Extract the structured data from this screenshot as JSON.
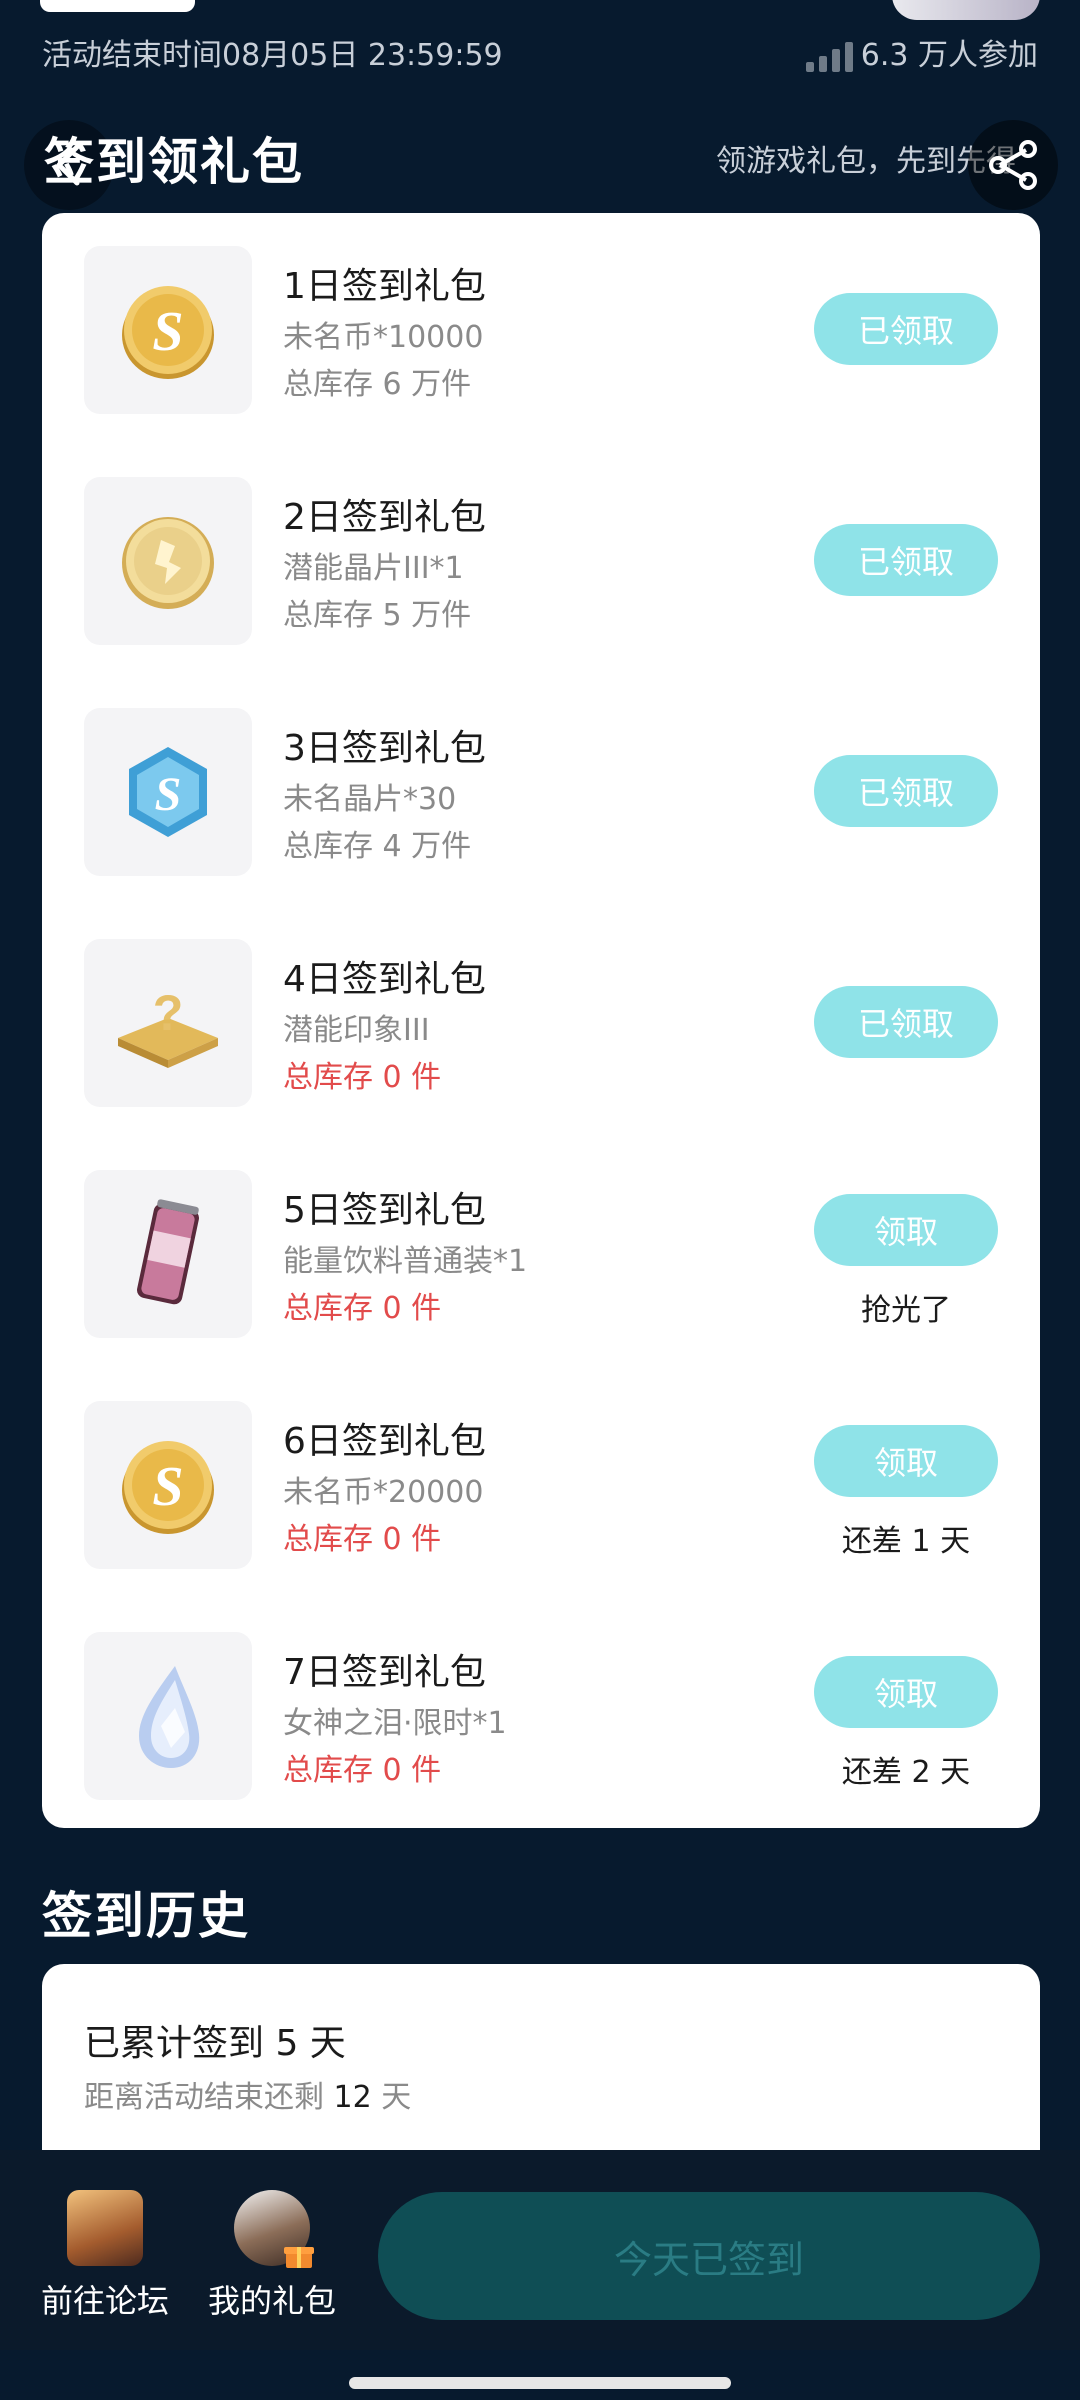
{
  "status": {
    "activity_end_time": "活动结束时间08月05日 23:59:59",
    "participants": "6.3 万人参加"
  },
  "header": {
    "title": "签到领礼包",
    "promo": "领游戏礼包，先到先得"
  },
  "gifts": [
    {
      "title": "1日签到礼包",
      "item": "未名币*10000",
      "stock": "总库存 6 万件",
      "button": "已领取",
      "note": "",
      "icon": "coin-s-icon"
    },
    {
      "title": "2日签到礼包",
      "item": "潜能晶片III*1",
      "stock": "总库存 5 万件",
      "button": "已领取",
      "note": "",
      "icon": "gold-chip-icon"
    },
    {
      "title": "3日签到礼包",
      "item": "未名晶片*30",
      "stock": "总库存 4 万件",
      "button": "已领取",
      "note": "",
      "icon": "hexagon-crystal-icon"
    },
    {
      "title": "4日签到礼包",
      "item": "潜能印象III",
      "stock": "总库存 0 件",
      "button": "已领取",
      "note": "",
      "icon": "mystery-box-icon"
    },
    {
      "title": "5日签到礼包",
      "item": "能量饮料普通装*1",
      "stock": "总库存 0 件",
      "button": "领取",
      "note": "抢光了",
      "icon": "energy-drink-icon"
    },
    {
      "title": "6日签到礼包",
      "item": "未名币*20000",
      "stock": "总库存 0 件",
      "button": "领取",
      "note": "还差 1 天",
      "icon": "coin-s-icon"
    },
    {
      "title": "7日签到礼包",
      "item": "女神之泪·限时*1",
      "stock": "总库存 0 件",
      "button": "领取",
      "note": "还差 2 天",
      "icon": "teardrop-gem-icon"
    }
  ],
  "history": {
    "heading": "签到历史",
    "total": "已累计签到 5 天",
    "remain_prefix": "距离活动结束还剩 ",
    "remain_days": "12",
    "remain_suffix": " 天"
  },
  "bottom": {
    "forum": "前往论坛",
    "my_gifts": "我的礼包",
    "checkin": "今天已签到"
  },
  "colors": {
    "background": "#071a2e",
    "button_teal": "#8fe3e8",
    "stock_empty": "#e24b4b"
  }
}
